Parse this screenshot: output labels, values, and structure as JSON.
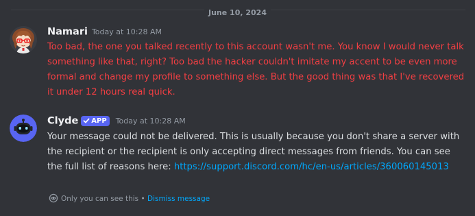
{
  "divider": {
    "date": "June 10, 2024"
  },
  "messages": [
    {
      "username": "Namari",
      "timestamp": "Today at 10:28 AM",
      "text": "Too bad, the one you talked recently to this account wasn't me. You know I would never talk something like that, right? Too bad the hacker couldn't imitate my accent to be even more formal and change my profile to something else. But the good thing was that I've recovered it under 12 hours real quick."
    },
    {
      "username": "Clyde",
      "badge": "APP",
      "timestamp": "Today at 10:28 AM",
      "text_before_link": "Your message could not be delivered. This is usually because you don't share a server with the recipient or the recipient is only accepting direct messages from friends. You can see the full list of reasons here: ",
      "link": "https://support.discord.com/hc/en-us/articles/360060145013"
    }
  ],
  "ephemeral": {
    "note": "Only you can see this",
    "separator": " • ",
    "dismiss_label": "Dismiss message"
  },
  "colors": {
    "background": "#313338",
    "error_text": "#f23f43",
    "link": "#00a8fc",
    "badge": "#5865f2"
  }
}
